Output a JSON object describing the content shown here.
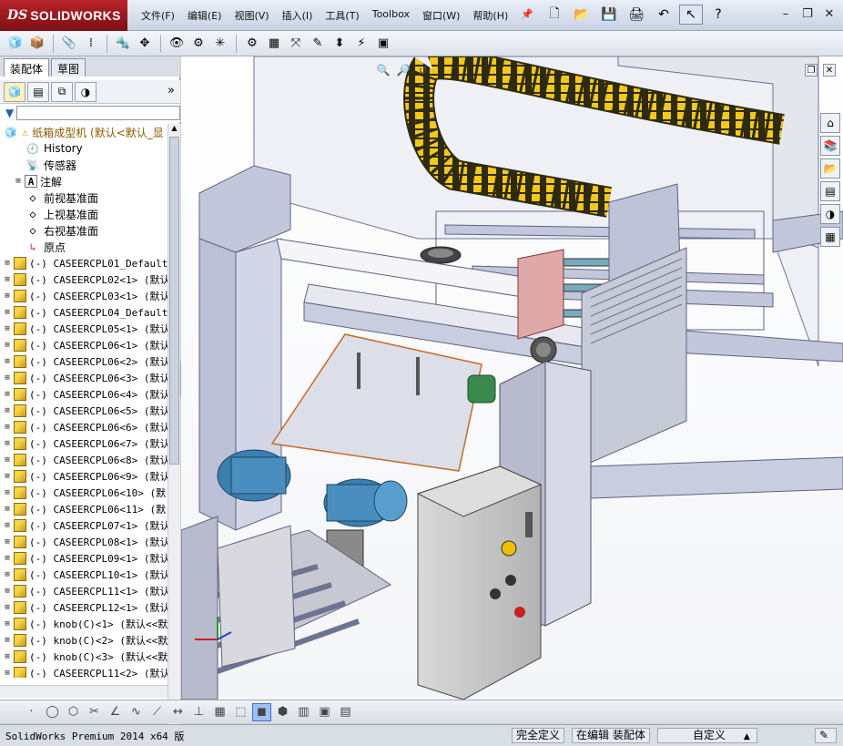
{
  "app": {
    "logo_prefix": "DS",
    "logo_text": "SOLIDWORKS"
  },
  "menu": [
    "文件(F)",
    "编辑(E)",
    "视图(V)",
    "插入(I)",
    "工具(T)",
    "Toolbox",
    "窗口(W)",
    "帮助(H)"
  ],
  "left_panel": {
    "tabs": [
      "装配体",
      "草图"
    ],
    "tree_root": "纸箱成型机  (默认<默认_显",
    "tree_items": [
      {
        "label": "History",
        "icon": "history-icon",
        "kind": "special"
      },
      {
        "label": "传感器",
        "icon": "sensor-icon",
        "kind": "special"
      },
      {
        "label": "注解",
        "icon": "annotation-icon",
        "kind": "special",
        "expandable": true
      },
      {
        "label": "前视基准面",
        "icon": "plane-icon",
        "kind": "plane"
      },
      {
        "label": "上视基准面",
        "icon": "plane-icon",
        "kind": "plane"
      },
      {
        "label": "右视基准面",
        "icon": "plane-icon",
        "kind": "plane"
      },
      {
        "label": "原点",
        "icon": "origin-icon",
        "kind": "origin"
      },
      {
        "label": "(-) CASEERCPL01_Default",
        "kind": "part"
      },
      {
        "label": "(-) CASEERCPL02<1> (默认",
        "kind": "part"
      },
      {
        "label": "(-) CASEERCPL03<1> (默认",
        "kind": "part"
      },
      {
        "label": "(-) CASEERCPL04_Default",
        "kind": "part"
      },
      {
        "label": "(-) CASEERCPL05<1> (默认",
        "kind": "part"
      },
      {
        "label": "(-) CASEERCPL06<1> (默认",
        "kind": "part"
      },
      {
        "label": "(-) CASEERCPL06<2> (默认",
        "kind": "part"
      },
      {
        "label": "(-) CASEERCPL06<3> (默认",
        "kind": "part"
      },
      {
        "label": "(-) CASEERCPL06<4> (默认",
        "kind": "part"
      },
      {
        "label": "(-) CASEERCPL06<5> (默认",
        "kind": "part"
      },
      {
        "label": "(-) CASEERCPL06<6> (默认",
        "kind": "part"
      },
      {
        "label": "(-) CASEERCPL06<7> (默认",
        "kind": "part"
      },
      {
        "label": "(-) CASEERCPL06<8> (默认",
        "kind": "part"
      },
      {
        "label": "(-) CASEERCPL06<9> (默认",
        "kind": "part"
      },
      {
        "label": "(-) CASEERCPL06<10> (默",
        "kind": "part"
      },
      {
        "label": "(-) CASEERCPL06<11> (默",
        "kind": "part"
      },
      {
        "label": "(-) CASEERCPL07<1> (默认",
        "kind": "part"
      },
      {
        "label": "(-) CASEERCPL08<1> (默认",
        "kind": "part"
      },
      {
        "label": "(-) CASEERCPL09<1> (默认",
        "kind": "part"
      },
      {
        "label": "(-) CASEERCPL10<1> (默认",
        "kind": "part"
      },
      {
        "label": "(-) CASEERCPL11<1> (默认",
        "kind": "part"
      },
      {
        "label": "(-) CASEERCPL12<1> (默认",
        "kind": "part"
      },
      {
        "label": "(-) knob(C)<1> (默认<<默",
        "kind": "part"
      },
      {
        "label": "(-) knob(C)<2> (默认<<默",
        "kind": "part"
      },
      {
        "label": "(-) knob(C)<3> (默认<<默",
        "kind": "part"
      },
      {
        "label": "(-) CASEERCPL11<2> (默认",
        "kind": "part"
      }
    ]
  },
  "status": {
    "product": "SolidWorks Premium 2014 x64 版",
    "definition": "完全定义",
    "mode": "在编辑 装配体",
    "units": "自定义"
  },
  "colors": {
    "title_bg": "#c9d3e4",
    "logo_red": "#b8232a",
    "frame_steel": "#b9bfd6",
    "cable_chain": "#f2c81c",
    "motor_blue": "#3b7fb0",
    "cabinet_grey": "#c8c8c8"
  }
}
